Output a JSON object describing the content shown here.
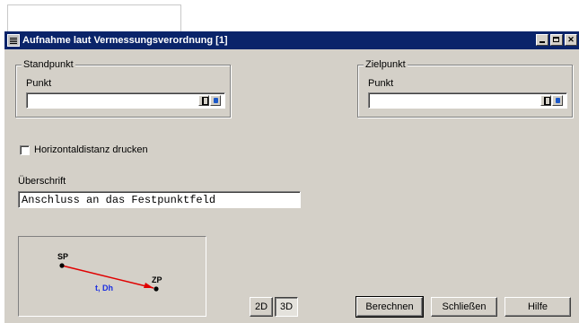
{
  "window": {
    "title": "Aufnahme laut Vermessungsverordnung [1]",
    "controls": [
      "minimize",
      "maximize",
      "close"
    ]
  },
  "standpunkt": {
    "group_label": "Standpunkt",
    "field_label": "Punkt",
    "value": ""
  },
  "zielpunkt": {
    "group_label": "Zielpunkt",
    "field_label": "Punkt",
    "value": ""
  },
  "horizontal_distance": {
    "label": "Horizontaldistanz drucken",
    "checked": false
  },
  "ueberschrift": {
    "label": "Überschrift",
    "value": "Anschluss an das Festpunktfeld"
  },
  "diagram": {
    "start_label": "SP",
    "end_label": "ZP",
    "line_label": "t, Dh",
    "line_color": "#e00000",
    "label_color": "#1a2ee0"
  },
  "view_toggle": {
    "option_2d": "2D",
    "option_3d": "3D",
    "selected": "3D"
  },
  "buttons": {
    "calculate": "Berechnen",
    "close": "Schließen",
    "help": "Hilfe"
  }
}
